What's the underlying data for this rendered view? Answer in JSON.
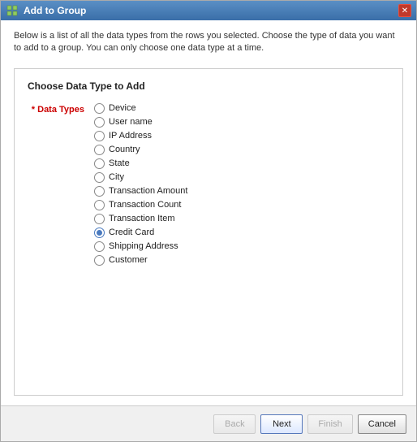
{
  "window": {
    "title": "Add to Group",
    "close_label": "✕"
  },
  "description": "Below is a list of all the data types from the rows you selected. Choose the type of data you want to add to a group. You can only choose one data type at a time.",
  "section": {
    "title": "Choose Data Type to Add",
    "field_label": "* Data Types",
    "required_marker": "*",
    "field_name": "Data Types"
  },
  "data_types": [
    {
      "id": "device",
      "label": "Device",
      "checked": false
    },
    {
      "id": "username",
      "label": "User name",
      "checked": false
    },
    {
      "id": "ipaddress",
      "label": "IP Address",
      "checked": false
    },
    {
      "id": "country",
      "label": "Country",
      "checked": false
    },
    {
      "id": "state",
      "label": "State",
      "checked": false
    },
    {
      "id": "city",
      "label": "City",
      "checked": false
    },
    {
      "id": "transaction_amount",
      "label": "Transaction Amount",
      "checked": false
    },
    {
      "id": "transaction_count",
      "label": "Transaction Count",
      "checked": false
    },
    {
      "id": "transaction_item",
      "label": "Transaction Item",
      "checked": false
    },
    {
      "id": "credit_card",
      "label": "Credit Card",
      "checked": true
    },
    {
      "id": "shipping_address",
      "label": "Shipping Address",
      "checked": false
    },
    {
      "id": "customer",
      "label": "Customer",
      "checked": false
    }
  ],
  "buttons": {
    "back": "Back",
    "next": "Next",
    "finish": "Finish",
    "cancel": "Cancel"
  }
}
